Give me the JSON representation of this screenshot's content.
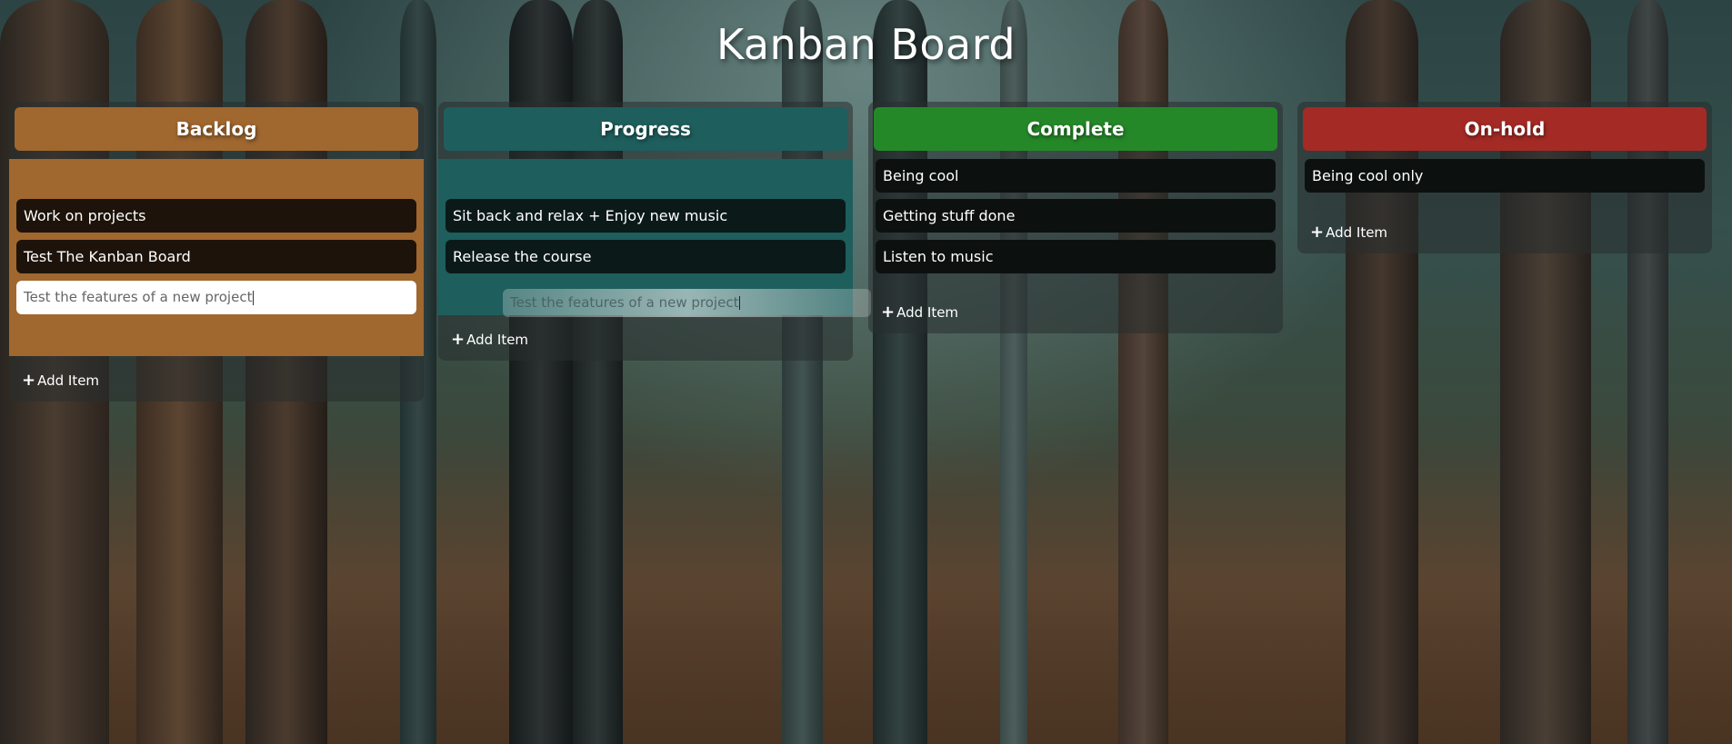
{
  "page": {
    "title": "Kanban Board"
  },
  "colors": {
    "backlog": "#a0672f",
    "progress": "#1e5e5c",
    "complete": "#258828",
    "onhold": "#a42a25",
    "card_dark": "#1d130a",
    "card_progress": "#0b1a19",
    "card_complete": "#0c1110"
  },
  "columns": {
    "backlog": {
      "title": "Backlog",
      "items": [
        "Work on projects",
        "Test The Kanban Board"
      ],
      "input_value": "Test the features of a new project",
      "add_label": "Add Item"
    },
    "progress": {
      "title": "Progress",
      "items": [
        "Sit back and relax + Enjoy new music",
        "Release the course"
      ],
      "add_label": "Add Item"
    },
    "complete": {
      "title": "Complete",
      "items": [
        "Being cool",
        "Getting stuff done",
        "Listen to music"
      ],
      "add_label": "Add Item"
    },
    "onhold": {
      "title": "On-hold",
      "items": [
        "Being cool only"
      ],
      "add_label": "Add Item"
    }
  },
  "drag": {
    "ghost_text": "Test the features of a new project"
  },
  "icons": {
    "add": "plus-icon"
  }
}
